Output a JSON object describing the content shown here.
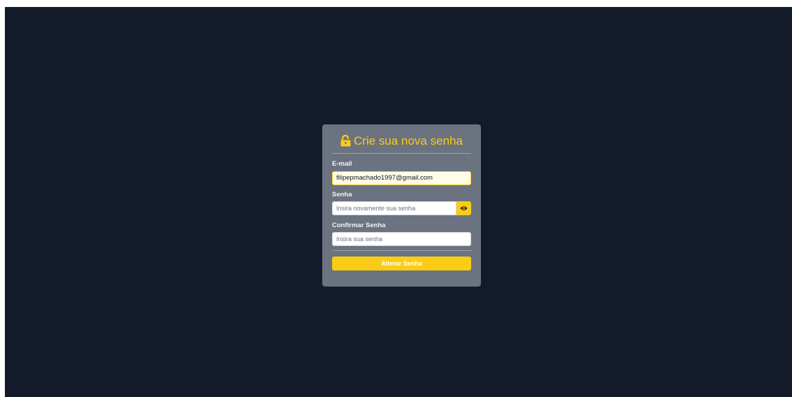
{
  "form": {
    "title": "Crie sua nova senha",
    "email": {
      "label": "E-mail",
      "value": "filipepmachado1997@gmail.com"
    },
    "password": {
      "label": "Senha",
      "placeholder": "Insira novamente sua senha"
    },
    "confirm_password": {
      "label": "Confirmar Senha",
      "placeholder": "Insira sua senha"
    },
    "submit_label": "Alterar Senha"
  },
  "icons": {
    "title_icon": "unlock-icon",
    "toggle_icon": "eye-icon"
  },
  "colors": {
    "background": "#131a2a",
    "card": "#6b7280",
    "accent": "#facc15"
  }
}
